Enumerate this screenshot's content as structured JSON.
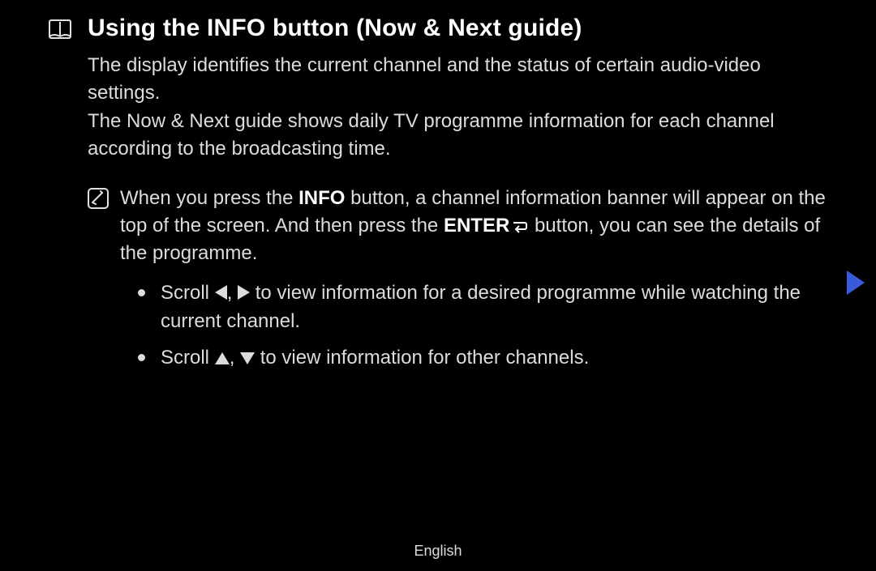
{
  "heading": "Using the INFO button (Now & Next guide)",
  "para1": "The display identifies the current channel and the status of certain audio-video settings.",
  "para2": "The Now & Next guide shows daily TV programme information for each channel according to the broadcasting time.",
  "note": {
    "pre1": "When you press the ",
    "info": "INFO",
    "mid1": " button, a channel information banner will appear on the top of the screen. And then press the ",
    "enter": "ENTER",
    "post1": " button, you can see the details of the programme."
  },
  "bullets": {
    "b1_pre": "Scroll ",
    "b1_post": " to view information for a desired programme while watching the current channel.",
    "b2_pre": "Scroll ",
    "b2_post": " to view information for other channels."
  },
  "footer": "English"
}
